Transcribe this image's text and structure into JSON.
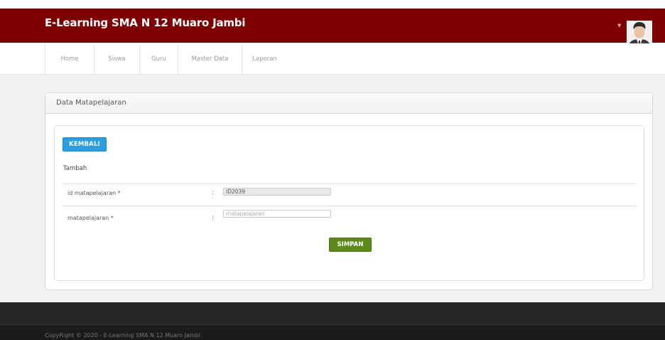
{
  "header": {
    "brand": "E-Learning SMA N 12 Muaro Jambi"
  },
  "nav": {
    "items": [
      {
        "label": "Home"
      },
      {
        "label": "Siswa"
      },
      {
        "label": "Guru"
      },
      {
        "label": "Master Data"
      },
      {
        "label": "Laporan"
      }
    ]
  },
  "panel": {
    "title": "Data Matapelajaran",
    "back_label": "KEMBALI",
    "section": "Tambah",
    "fields": [
      {
        "label": "id matapelajaran *",
        "value": "ID2039",
        "placeholder": ""
      },
      {
        "label": "matapelajaran *",
        "value": "",
        "placeholder": "matapelajaran"
      }
    ],
    "colon": ":",
    "save_label": "SIMPAN"
  },
  "footer": {
    "copyright": "CopyRight © 2020 - E-Learning SMA N 12 Muaro Jambi"
  },
  "colors": {
    "header_bg": "#7d0000",
    "primary_button": "#2a9ee0",
    "success_button": "#5e8a1d",
    "footer_bg": "#262626"
  },
  "icons": {
    "caret": "chevron-down-icon",
    "avatar": "user-avatar-icon"
  }
}
